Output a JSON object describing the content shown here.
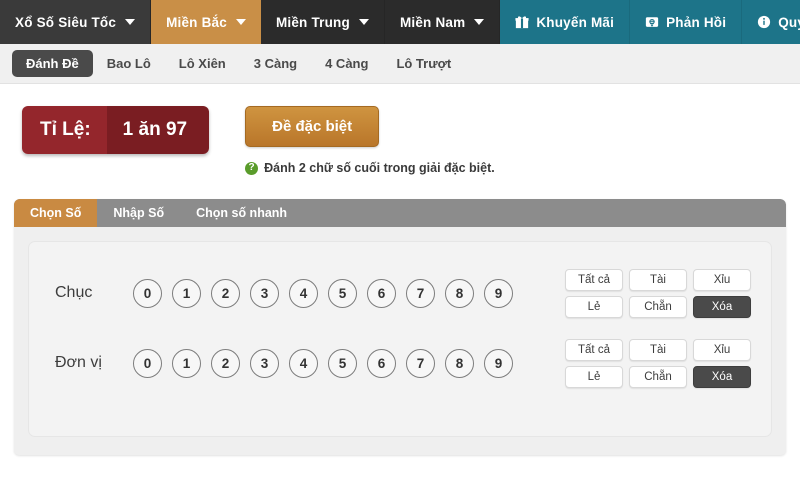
{
  "topnav": {
    "items": [
      {
        "label": "Xổ Số Siêu Tốc",
        "style": "first",
        "caret": true,
        "icon": null
      },
      {
        "label": "Miền Bắc",
        "style": "active",
        "caret": true,
        "icon": null
      },
      {
        "label": "Miền Trung",
        "style": "dark",
        "caret": true,
        "icon": null
      },
      {
        "label": "Miền Nam",
        "style": "dark",
        "caret": true,
        "icon": null
      },
      {
        "label": "Khuyến Mãi",
        "style": "teal",
        "caret": false,
        "icon": "gift-icon"
      },
      {
        "label": "Phản Hồi",
        "style": "teal",
        "caret": false,
        "icon": "feedback-icon"
      },
      {
        "label": "Quy Định",
        "style": "teal last",
        "caret": false,
        "icon": "info-icon"
      }
    ]
  },
  "subtabs": {
    "items": [
      {
        "label": "Đánh Đề",
        "active": true
      },
      {
        "label": "Bao Lô",
        "active": false
      },
      {
        "label": "Lô Xiên",
        "active": false
      },
      {
        "label": "3 Càng",
        "active": false
      },
      {
        "label": "4 Càng",
        "active": false
      },
      {
        "label": "Lô Trượt",
        "active": false
      }
    ]
  },
  "ratio": {
    "label": "Tỉ Lệ:",
    "value": "1 ăn 97"
  },
  "special_button": {
    "label": "Đề đặc biệt"
  },
  "hint": {
    "icon": "question-icon",
    "icon_glyph": "?",
    "text": "Đánh 2 chữ số cuối trong giải đặc biệt."
  },
  "panel": {
    "tabs": [
      {
        "label": "Chọn Số",
        "active": true
      },
      {
        "label": "Nhập Số",
        "active": false
      },
      {
        "label": "Chọn số nhanh",
        "active": false
      }
    ],
    "rows": [
      {
        "label": "Chục",
        "digits": [
          "0",
          "1",
          "2",
          "3",
          "4",
          "5",
          "6",
          "7",
          "8",
          "9"
        ],
        "buttons_top": [
          {
            "label": "Tất cả",
            "dark": false
          },
          {
            "label": "Tài",
            "dark": false
          },
          {
            "label": "Xỉu",
            "dark": false
          }
        ],
        "buttons_bottom": [
          {
            "label": "Lẻ",
            "dark": false
          },
          {
            "label": "Chẵn",
            "dark": false
          },
          {
            "label": "Xóa",
            "dark": true
          }
        ]
      },
      {
        "label": "Đơn vị",
        "digits": [
          "0",
          "1",
          "2",
          "3",
          "4",
          "5",
          "6",
          "7",
          "8",
          "9"
        ],
        "buttons_top": [
          {
            "label": "Tất cả",
            "dark": false
          },
          {
            "label": "Tài",
            "dark": false
          },
          {
            "label": "Xỉu",
            "dark": false
          }
        ],
        "buttons_bottom": [
          {
            "label": "Lẻ",
            "dark": false
          },
          {
            "label": "Chẵn",
            "dark": false
          },
          {
            "label": "Xóa",
            "dark": true
          }
        ]
      }
    ]
  },
  "colors": {
    "nav_dark": "#2b2b2b",
    "nav_active": "#c98f47",
    "nav_teal": "#1d7489",
    "ratio_label_bg": "#94262c",
    "ratio_value_bg": "#7a1d22",
    "special_button_bg": "#c08030",
    "panel_tab_active": "#c98a42",
    "panel_tab_bg": "#8c8c8c",
    "dark_button": "#4a4a4a",
    "hint_icon": "#5a9c2b"
  }
}
